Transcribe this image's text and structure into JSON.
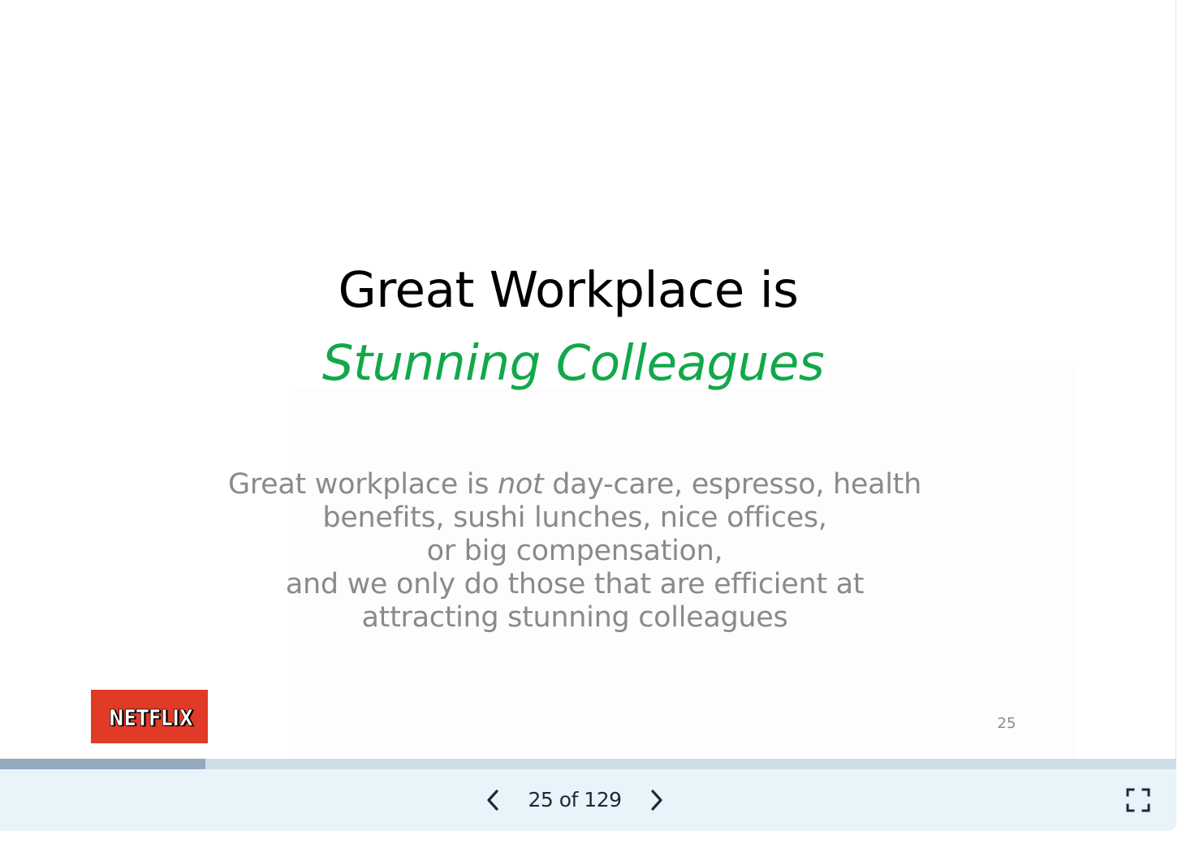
{
  "slide": {
    "title": "Great Workplace is",
    "subtitle": "Stunning Colleagues",
    "body": {
      "line1_before": "Great workplace is ",
      "line1_emphasis": "not",
      "line1_after": " day-care, espresso, health",
      "line2": "benefits, sushi lunches, nice offices,",
      "line3": "or big compensation,",
      "line4": "and we only do those that are efficient at",
      "line5": "attracting stunning colleagues"
    },
    "logo_text": "NETFLIX",
    "slide_number": "25"
  },
  "viewer": {
    "current_page": 25,
    "total_pages": 129,
    "page_indicator": "25 of 129",
    "progress_fraction": 0.1744,
    "icons": {
      "prev": "chevron-left-icon",
      "next": "chevron-right-icon",
      "fullscreen": "fullscreen-icon"
    }
  },
  "colors": {
    "title": "#000000",
    "subtitle": "#12a84a",
    "body_text": "#8a8a8a",
    "logo_bg": "#e13a26",
    "progress_track": "#cfdde7",
    "progress_fill": "#93a9be",
    "controls_bg": "#e8f4fa",
    "controls_text": "#1d2b38"
  }
}
